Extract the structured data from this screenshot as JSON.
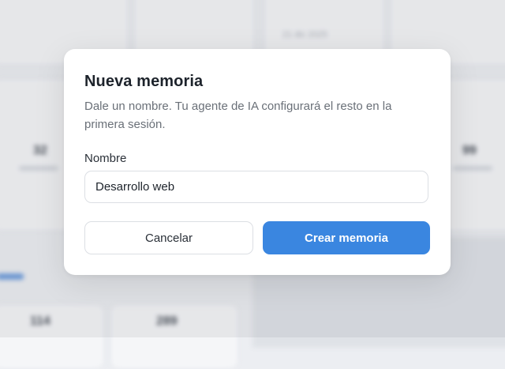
{
  "background": {
    "date_text": "21 dic 2025",
    "stats": [
      "32",
      "99",
      "114",
      "289"
    ]
  },
  "dialog": {
    "title": "Nueva memoria",
    "description": "Dale un nombre. Tu agente de IA configurará el resto en la primera sesión.",
    "name_label": "Nombre",
    "name_value": "Desarrollo web",
    "cancel_label": "Cancelar",
    "create_label": "Crear memoria"
  },
  "colors": {
    "accent": "#3a86e0",
    "title": "#1d232b",
    "muted": "#6a7078"
  }
}
